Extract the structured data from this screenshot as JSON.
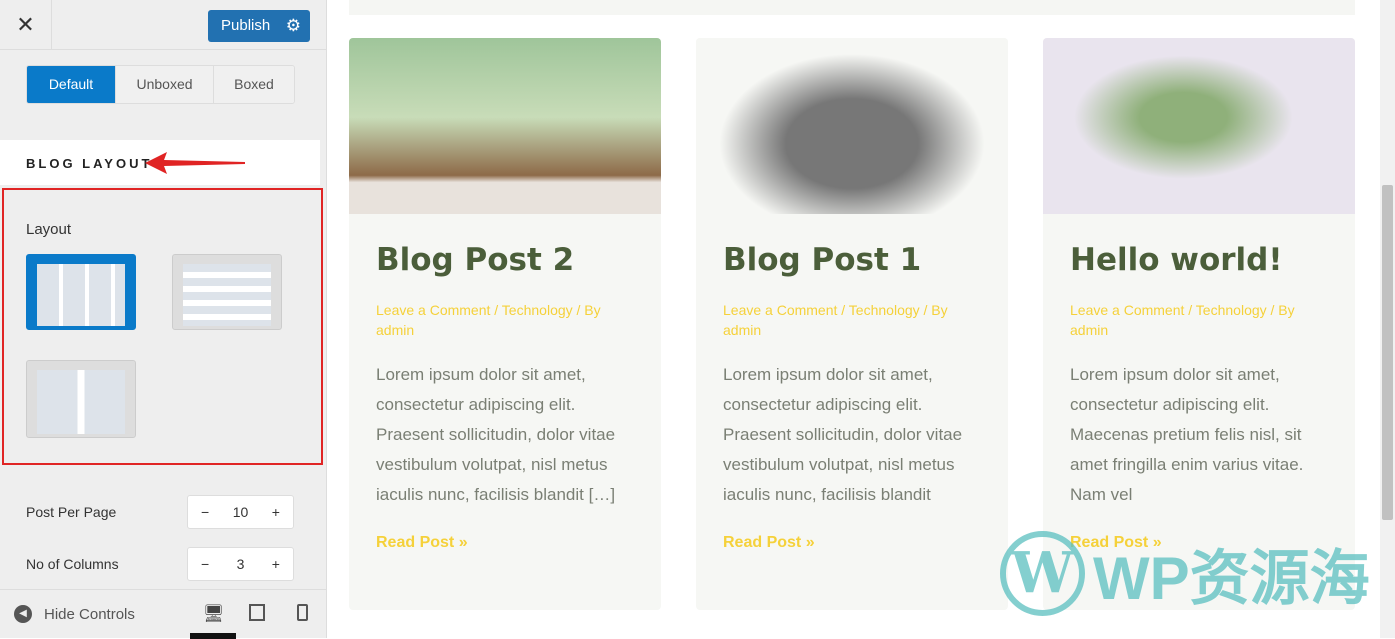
{
  "sidebar": {
    "publish_label": "Publish",
    "container_options": [
      "Default",
      "Unboxed",
      "Boxed"
    ],
    "selected_container": "Default",
    "section_title": "BLOG LAYOUT",
    "layout_label": "Layout",
    "selected_layout": 1,
    "post_per_page_label": "Post Per Page",
    "post_per_page": "10",
    "columns_label": "No of Columns",
    "columns": "3",
    "minus": "−",
    "plus": "+",
    "hide_controls": "Hide Controls"
  },
  "posts": [
    {
      "title": "Blog Post 2",
      "meta": "Leave a Comment / Technology / By admin",
      "excerpt": "Lorem ipsum dolor sit amet, consectetur adipiscing elit. Praesent sollicitudin, dolor vitae vestibulum volutpat, nisl metus iaculis nunc, facilisis blandit […]",
      "read_more": "Read Post »"
    },
    {
      "title": "Blog Post 1",
      "meta": "Leave a Comment / Technology / By admin",
      "excerpt": "Lorem ipsum dolor sit amet, consectetur adipiscing elit. Praesent sollicitudin, dolor vitae vestibulum volutpat, nisl metus iaculis nunc, facilisis blandit",
      "read_more": "Read Post »"
    },
    {
      "title": "Hello world!",
      "meta": "Leave a Comment / Technology / By admin",
      "excerpt": "Lorem ipsum dolor sit amet, consectetur adipiscing elit. Maecenas pretium felis nisl, sit amet fringilla enim varius vitae. Nam vel",
      "read_more": "Read Post »"
    }
  ],
  "watermark": "WP资源海",
  "colors": {
    "accent": "#0a7ac9",
    "publish": "#2271b1",
    "title": "#4b5e3a",
    "meta": "#f5d13a",
    "highlight": "#e02424"
  }
}
